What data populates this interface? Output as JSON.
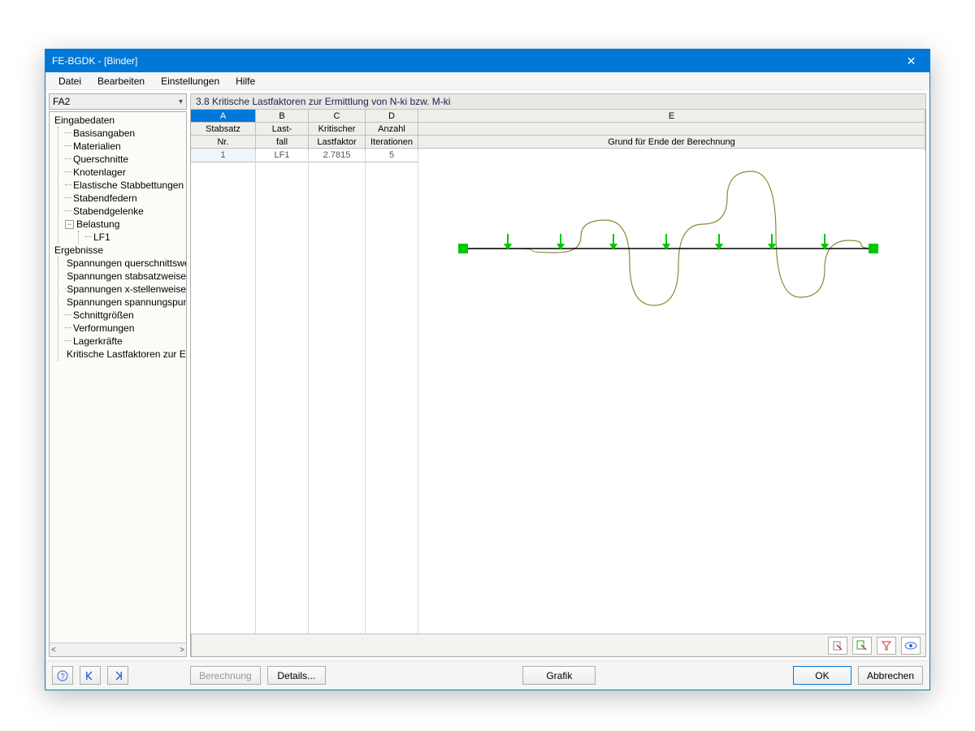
{
  "window": {
    "title": "FE-BGDK - [Binder]",
    "close_symbol": "✕"
  },
  "menu": {
    "file": "Datei",
    "edit": "Bearbeiten",
    "settings": "Einstellungen",
    "help": "Hilfe"
  },
  "sidebar": {
    "selector_value": "FA2",
    "groups": {
      "eingabe": "Eingabedaten",
      "ergebnisse": "Ergebnisse"
    },
    "eingabe_items": [
      "Basisangaben",
      "Materialien",
      "Querschnitte",
      "Knotenlager",
      "Elastische Stabbettungen",
      "Stabendfedern",
      "Stabendgelenke"
    ],
    "belastung": "Belastung",
    "belastung_children": [
      "LF1"
    ],
    "ergebnis_items": [
      "Spannungen querschnittsweise",
      "Spannungen stabsatzweise",
      "Spannungen x-stellenweise",
      "Spannungen spannungspunktweise",
      "Schnittgrößen",
      "Verformungen",
      "Lagerkräfte",
      "Kritische Lastfaktoren zur Ermittlung"
    ]
  },
  "panel": {
    "title": "3.8 Kritische Lastfaktoren zur Ermittlung von N-ki bzw. M-ki"
  },
  "grid": {
    "letters": [
      "A",
      "B",
      "C",
      "D",
      "E"
    ],
    "headers_line1": [
      "Stabsatz",
      "Last-",
      "Kritischer",
      "Anzahl",
      ""
    ],
    "headers_line2": [
      "Nr.",
      "fall",
      "Lastfaktor",
      "Iterationen",
      "Grund für Ende der Berechnung"
    ],
    "row": {
      "stabsatz": "1",
      "lastfall": "LF1",
      "faktor": "2.7815",
      "iter": "5",
      "grund": ""
    }
  },
  "chart_data": {
    "type": "line",
    "title": "",
    "xlabel": "",
    "ylabel": "",
    "x": [
      0,
      60,
      120,
      180,
      240,
      300,
      360,
      420,
      480,
      510
    ],
    "mode_shape_y": [
      0,
      0,
      -5,
      35,
      -70,
      30,
      95,
      -60,
      10,
      0
    ],
    "load_arrow_x": [
      60,
      125,
      190,
      255,
      320,
      385,
      450
    ],
    "support_left_x": 5,
    "support_right_x": 510,
    "beam_y": 120,
    "xlim": [
      0,
      520
    ],
    "ylim": [
      -100,
      100
    ]
  },
  "footer": {
    "berechnung": "Berechnung",
    "details": "Details...",
    "grafik": "Grafik",
    "ok": "OK",
    "cancel": "Abbrechen"
  },
  "scroll": {
    "left": "<",
    "right": ">"
  },
  "expander": {
    "minus": "−"
  }
}
